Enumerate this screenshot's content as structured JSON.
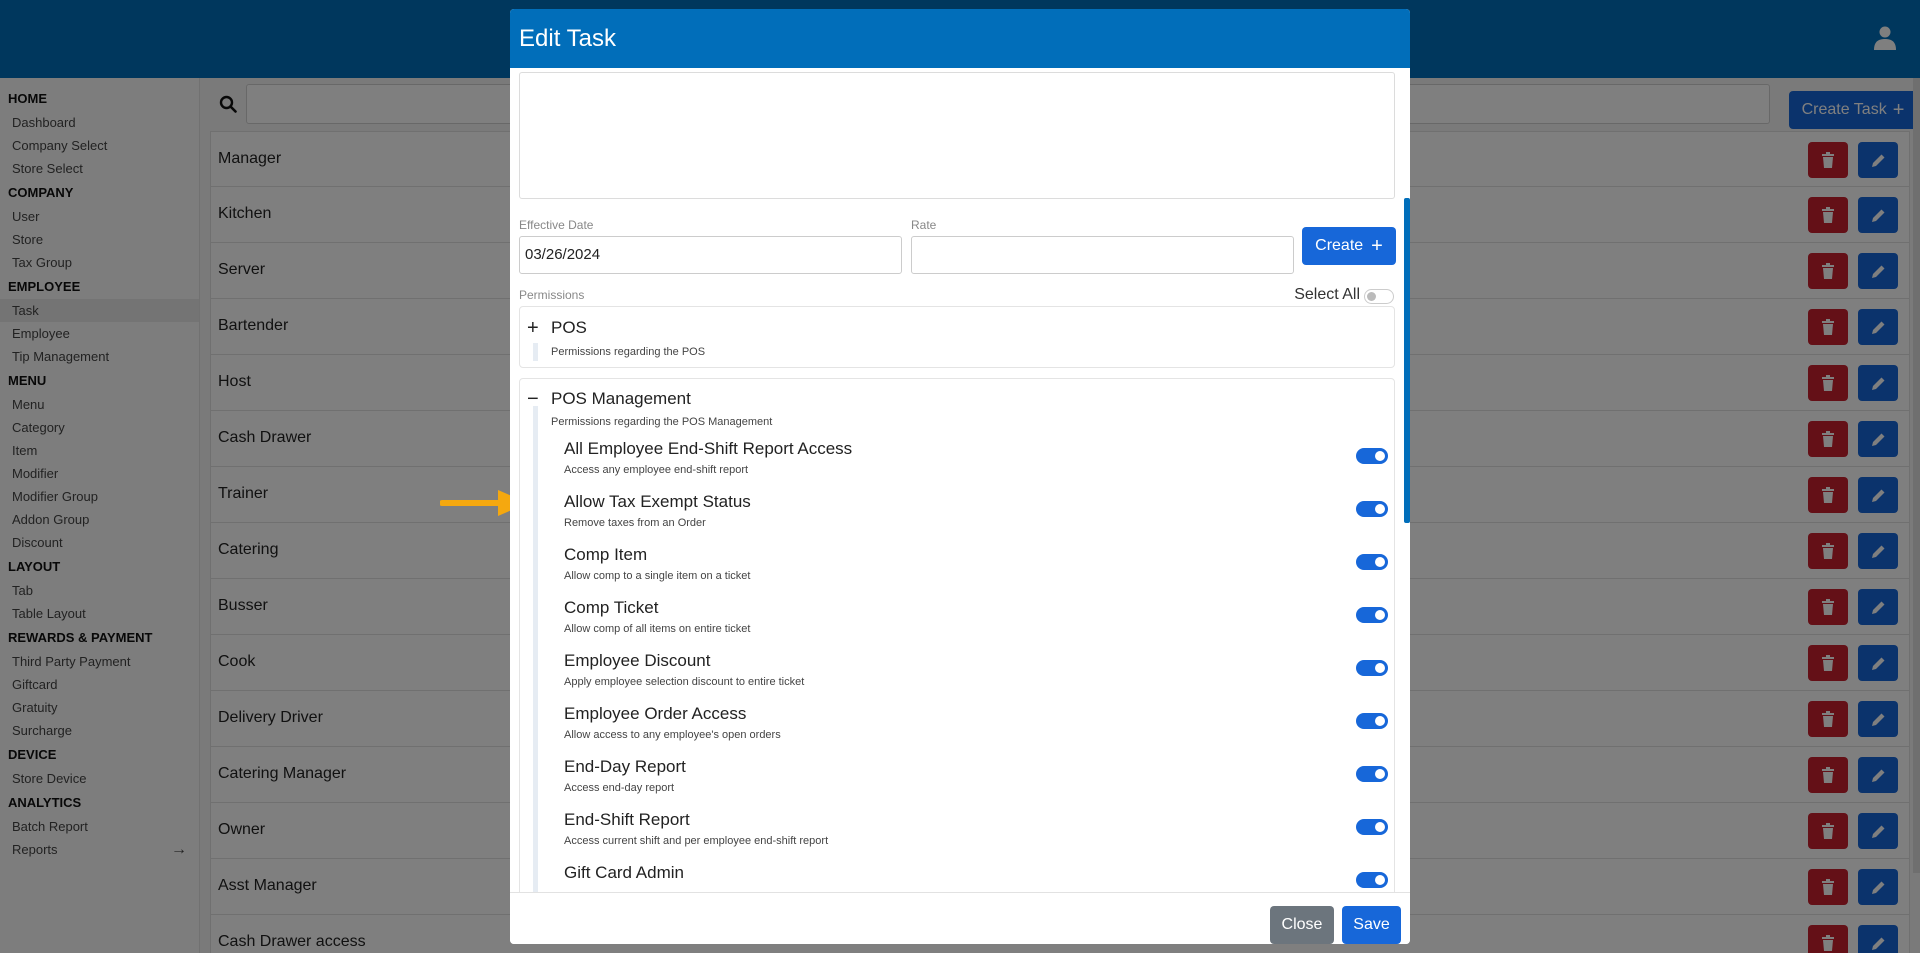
{
  "colors": {
    "brand": "#016eba",
    "primary": "#1767d9",
    "danger": "#c8202f",
    "secondary": "#6c757d",
    "annotation": "#f5a80f"
  },
  "header": {
    "user_icon": "user-icon"
  },
  "sidebar": {
    "sections": [
      {
        "title": "HOME",
        "items": [
          "Dashboard",
          "Company Select",
          "Store Select"
        ]
      },
      {
        "title": "COMPANY",
        "items": [
          "User",
          "Store",
          "Tax Group"
        ]
      },
      {
        "title": "EMPLOYEE",
        "items": [
          "Task",
          "Employee",
          "Tip Management"
        ]
      },
      {
        "title": "MENU",
        "items": [
          "Menu",
          "Category",
          "Item",
          "Modifier",
          "Modifier Group",
          "Addon Group",
          "Discount"
        ]
      },
      {
        "title": "LAYOUT",
        "items": [
          "Tab",
          "Table Layout"
        ]
      },
      {
        "title": "REWARDS & PAYMENT",
        "items": [
          "Third Party Payment",
          "Giftcard",
          "Gratuity",
          "Surcharge"
        ]
      },
      {
        "title": "DEVICE",
        "items": [
          "Store Device"
        ]
      },
      {
        "title": "ANALYTICS",
        "items": [
          "Batch Report",
          "Reports"
        ]
      }
    ],
    "active_item": "Task"
  },
  "toolbar": {
    "create_task_label": "Create Task"
  },
  "tasks": [
    "Manager",
    "Kitchen",
    "Server",
    "Bartender",
    "Host",
    "Cash Drawer",
    "Trainer",
    "Catering",
    "Busser",
    "Cook",
    "Delivery Driver",
    "Catering Manager",
    "Owner",
    "Asst Manager",
    "Cash Drawer access"
  ],
  "modal": {
    "title": "Edit Task",
    "effective_date_label": "Effective Date",
    "effective_date_value": "03/26/2024",
    "rate_label": "Rate",
    "rate_value": "",
    "create_label": "Create",
    "permissions_label": "Permissions",
    "select_all_label": "Select All",
    "select_all_on": false,
    "groups": [
      {
        "sign": "+",
        "title": "POS",
        "desc": "Permissions regarding the POS",
        "expanded": false
      },
      {
        "sign": "−",
        "title": "POS Management",
        "desc": "Permissions regarding the POS Management",
        "expanded": true
      }
    ],
    "permissions": [
      {
        "name": "All Employee End-Shift Report Access",
        "desc": "Access any employee end-shift report",
        "on": true
      },
      {
        "name": "Allow Tax Exempt Status",
        "desc": "Remove taxes from an Order",
        "on": true
      },
      {
        "name": "Comp Item",
        "desc": "Allow comp to a single item on a ticket",
        "on": true
      },
      {
        "name": "Comp Ticket",
        "desc": "Allow comp of all items on entire ticket",
        "on": true
      },
      {
        "name": "Employee Discount",
        "desc": "Apply employee selection discount to entire ticket",
        "on": true
      },
      {
        "name": "Employee Order Access",
        "desc": "Allow access to any employee's open orders",
        "on": true
      },
      {
        "name": "End-Day Report",
        "desc": "Access end-day report",
        "on": true
      },
      {
        "name": "End-Shift Report",
        "desc": "Access current shift and per employee end-shift report",
        "on": true
      },
      {
        "name": "Gift Card Admin",
        "desc": "",
        "on": true
      }
    ],
    "close_label": "Close",
    "save_label": "Save"
  }
}
